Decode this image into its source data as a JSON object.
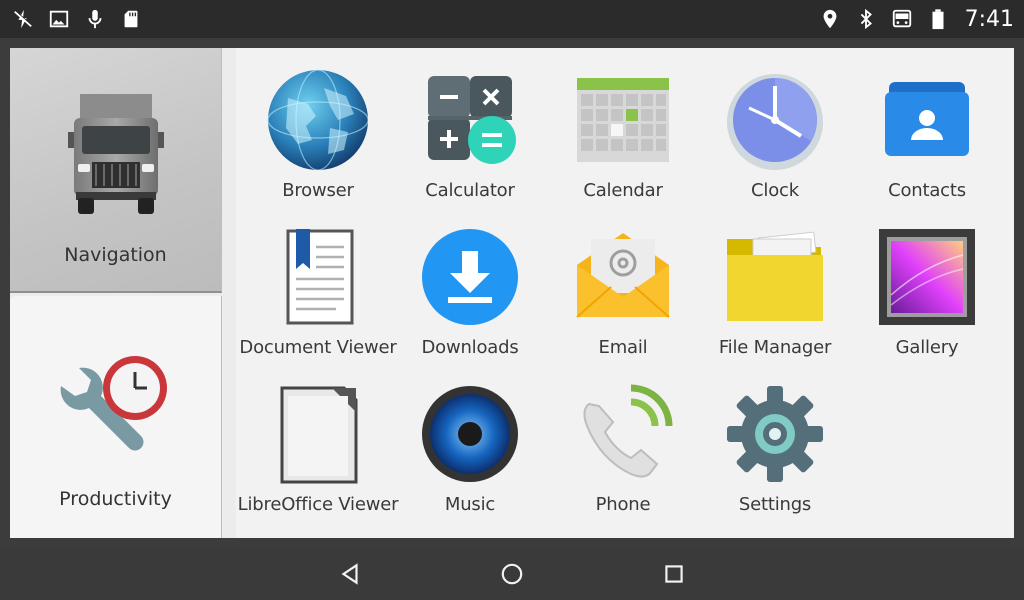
{
  "status_bar": {
    "left_icons": [
      "charging-off-icon",
      "image-icon",
      "microphone-icon",
      "sd-card-icon"
    ],
    "right_icons": [
      "location-icon",
      "bluetooth-icon",
      "car-mode-icon",
      "battery-icon"
    ],
    "time": "7:41"
  },
  "sidebar": {
    "categories": [
      {
        "label": "Navigation",
        "icon": "truck-icon",
        "selected": true
      },
      {
        "label": "Productivity",
        "icon": "wrench-clock-icon",
        "selected": false
      }
    ]
  },
  "apps": [
    {
      "label": "Browser",
      "icon": "globe-icon"
    },
    {
      "label": "Calculator",
      "icon": "calculator-icon"
    },
    {
      "label": "Calendar",
      "icon": "calendar-icon"
    },
    {
      "label": "Clock",
      "icon": "clock-icon"
    },
    {
      "label": "Contacts",
      "icon": "contacts-icon"
    },
    {
      "label": "Document Viewer",
      "icon": "document-icon"
    },
    {
      "label": "Downloads",
      "icon": "download-icon"
    },
    {
      "label": "Email",
      "icon": "email-icon"
    },
    {
      "label": "File Manager",
      "icon": "folder-icon"
    },
    {
      "label": "Gallery",
      "icon": "gallery-icon"
    },
    {
      "label": "LibreOffice Viewer",
      "icon": "libreoffice-icon"
    },
    {
      "label": "Music",
      "icon": "speaker-icon"
    },
    {
      "label": "Phone",
      "icon": "phone-icon"
    },
    {
      "label": "Settings",
      "icon": "gear-icon"
    }
  ],
  "nav_bar": {
    "buttons": [
      "back-icon",
      "home-icon",
      "recents-icon"
    ]
  },
  "colors": {
    "status_bar": "#2b2b2b",
    "nav_bar": "#3a3a3a",
    "grid_bg": "#f2f2f2"
  }
}
